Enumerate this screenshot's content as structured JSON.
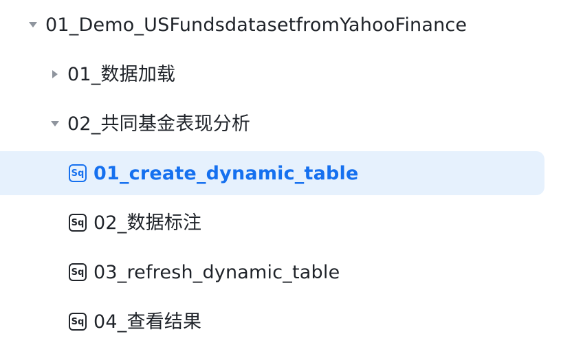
{
  "tree": {
    "root": {
      "label": "01_Demo_USFundsdatasetfromYahooFinance",
      "state": "expanded",
      "children": [
        {
          "label": "01_数据加载",
          "state": "collapsed"
        },
        {
          "label": "02_共同基金表现分析",
          "state": "expanded",
          "children": [
            {
              "label": "01_create_dynamic_table",
              "icon": "sql-file-icon",
              "icon_text": "Sq",
              "selected": true
            },
            {
              "label": "02_数据标注",
              "icon": "sql-file-icon",
              "icon_text": "Sq",
              "selected": false
            },
            {
              "label": "03_refresh_dynamic_table",
              "icon": "sql-file-icon",
              "icon_text": "Sq",
              "selected": false
            },
            {
              "label": "04_查看结果",
              "icon": "sql-file-icon",
              "icon_text": "Sq",
              "selected": false
            }
          ]
        }
      ]
    }
  },
  "colors": {
    "text": "#1f2329",
    "toggle": "#8f959e",
    "selected_text": "#1570ef",
    "selected_background": "#e6f1fd"
  }
}
